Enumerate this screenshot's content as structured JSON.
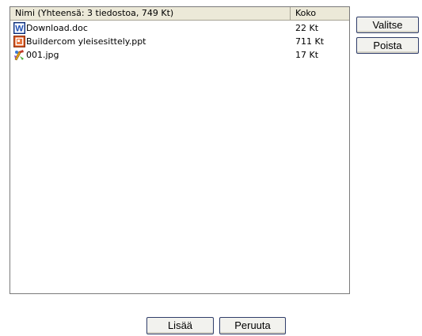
{
  "file_list": {
    "columns": {
      "name_header": "Nimi  (Yhteensä: 3 tiedostoa, 749 Kt)",
      "size_header": "Koko"
    },
    "files": [
      {
        "name": "Download.doc",
        "size": "22 Kt",
        "icon": "word-document-icon"
      },
      {
        "name": "Buildercom yleisesittely.ppt",
        "size": "711 Kt",
        "icon": "powerpoint-document-icon"
      },
      {
        "name": "001.jpg",
        "size": "17 Kt",
        "icon": "image-file-icon"
      }
    ]
  },
  "side_buttons": {
    "select_label": "Valitse",
    "remove_label": "Poista"
  },
  "bottom_buttons": {
    "add_label": "Lisää",
    "cancel_label": "Peruuta"
  },
  "colors": {
    "header_bg": "#ece9d8",
    "word_blue": "#1f4fb4",
    "ppt_orange": "#d5531e",
    "button_border": "#2f3d6a"
  }
}
